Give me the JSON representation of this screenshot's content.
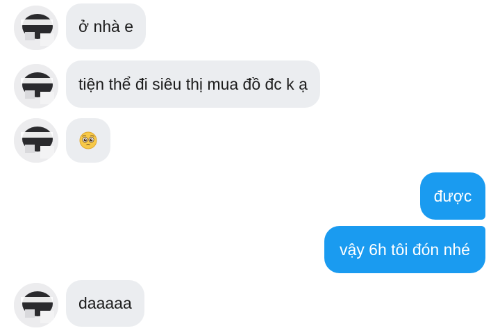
{
  "messages": [
    {
      "side": "in",
      "text": "ở nhà e"
    },
    {
      "side": "in",
      "text": "tiện thể đi siêu thị mua đồ đc k ạ"
    },
    {
      "side": "in",
      "text": "",
      "emoji": "pleading-face-icon"
    },
    {
      "side": "out",
      "text": "được"
    },
    {
      "side": "out",
      "text": "vậy 6h tôi đón nhé"
    },
    {
      "side": "in",
      "text": "daaaaa"
    }
  ],
  "colors": {
    "incoming_bubble": "#ebedf0",
    "outgoing_bubble": "#1a9bf0",
    "incoming_text": "#1c1c1c",
    "outgoing_text": "#ffffff"
  }
}
